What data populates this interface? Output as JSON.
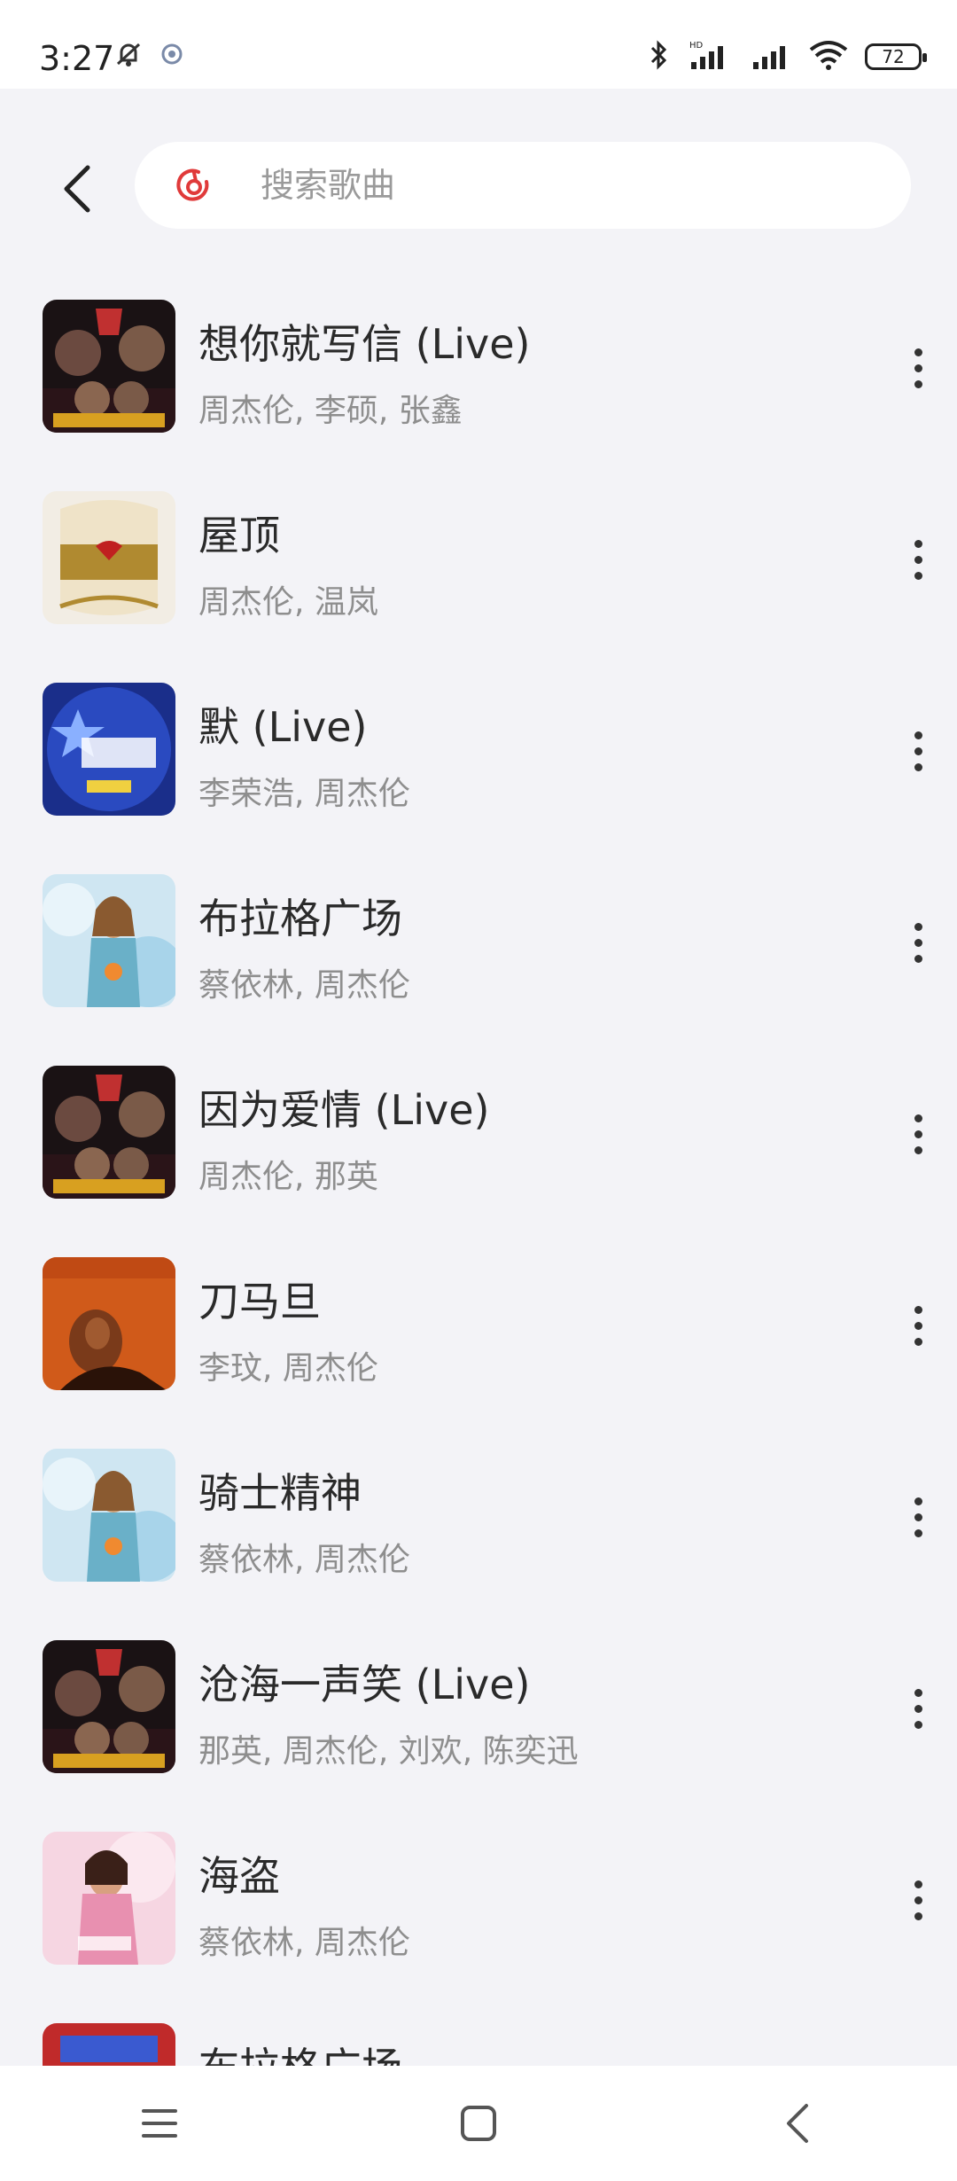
{
  "status_bar": {
    "time": "3:27",
    "battery": "72",
    "icons": [
      "mute-icon",
      "app-notification-icon",
      "bluetooth-icon",
      "signal-hd-icon",
      "signal-icon",
      "wifi-icon",
      "battery-icon"
    ]
  },
  "search": {
    "placeholder": "搜索歌曲",
    "value": "",
    "brand_color": "#e03a3a"
  },
  "songs": [
    {
      "title": "想你就写信 (Live)",
      "artists": "周杰伦, 李硕, 张鑫",
      "cover": "sing-china-13"
    },
    {
      "title": "屋顶",
      "artists": "周杰伦, 温岚",
      "cover": "love-songs-collection"
    },
    {
      "title": "默 (Live)",
      "artists": "李荣浩, 周杰伦",
      "cover": "voice-of-china-1"
    },
    {
      "title": "布拉格广场",
      "artists": "蔡依林, 周杰伦",
      "cover": "jolin-blue"
    },
    {
      "title": "因为爱情 (Live)",
      "artists": "周杰伦, 那英",
      "cover": "sing-china-1"
    },
    {
      "title": "刀马旦",
      "artists": "李玟, 周杰伦",
      "cover": "promise-coco"
    },
    {
      "title": "骑士精神",
      "artists": "蔡依林, 周杰伦",
      "cover": "jolin-blue"
    },
    {
      "title": "沧海一声笑 (Live)",
      "artists": "那英, 周杰伦, 刘欢, 陈奕迅",
      "cover": "sing-china-1"
    },
    {
      "title": "海盗",
      "artists": "蔡依林, 周杰伦",
      "cover": "jolin-pink"
    },
    {
      "title": "布拉格广场",
      "artists": "",
      "cover": "red-partial"
    }
  ]
}
